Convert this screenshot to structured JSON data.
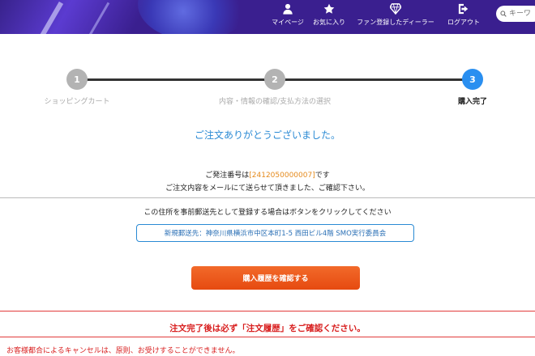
{
  "header": {
    "nav": [
      {
        "label": "マイページ",
        "icon": "person-icon"
      },
      {
        "label": "お気に入り",
        "icon": "star-icon"
      },
      {
        "label": "ファン登録したディーラー",
        "icon": "diamond-icon"
      },
      {
        "label": "ログアウト",
        "icon": "logout-icon"
      }
    ],
    "search_placeholder": "キーワ"
  },
  "steps": [
    {
      "number": "1",
      "label": "ショッピングカート",
      "state": "done"
    },
    {
      "number": "2",
      "label": "内容・情報の確認/支払方法の選択",
      "state": "done"
    },
    {
      "number": "3",
      "label": "購入完了",
      "state": "current"
    }
  ],
  "colors": {
    "step_inactive": "#b3b3b3",
    "step_active": "#2a8ff0",
    "accent": "#2a8ad4",
    "order_number": "#e58a1c",
    "warning": "#d81e1e",
    "button": "#ed5a1c"
  },
  "main": {
    "thanks": "ご注文ありがとうございました。",
    "order_prefix": "ご発注番号は",
    "order_number": "[2412050000007]",
    "order_suffix": "です",
    "mail_note": "ご注文内容をメールにて送らせて頂きました、ご確認下さい。",
    "address_note": "この住所を事前郵送先として登録する場合はボタンをクリックしてください",
    "address_button": "新規郵送先：神奈川県横浜市中区本町1-5 西田ビル4階 SMO実行委員会",
    "history_button": "購入履歴を確認する"
  },
  "warning": {
    "title": "注文完了後は必ず「注文履歴」をご確認ください。",
    "text": "お客様都合によるキャンセルは、原則、お受けすることができません。"
  }
}
